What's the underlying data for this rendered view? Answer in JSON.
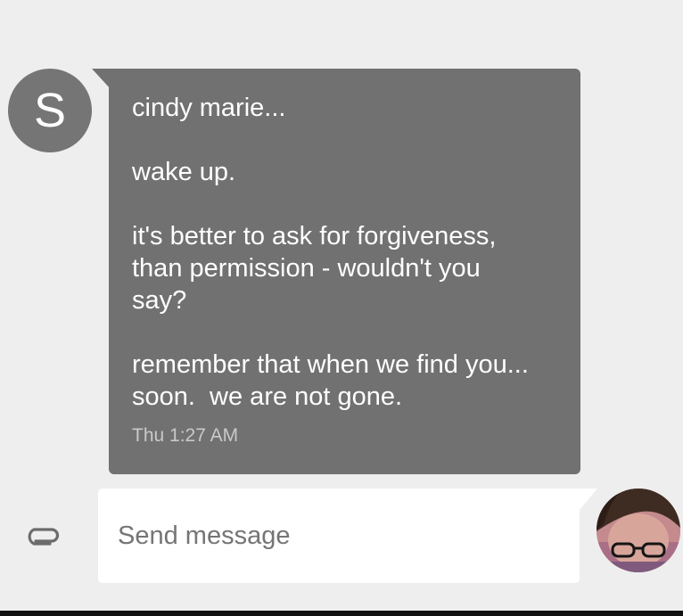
{
  "conversation": {
    "sender_initial": "S",
    "messages": [
      {
        "direction": "incoming",
        "paragraphs": [
          [
            "cindy marie..."
          ],
          [
            "wake up."
          ],
          [
            "it's better to ask for forgiveness,",
            "than permission - wouldn't you",
            "say?"
          ],
          [
            "remember that when we find you...",
            "soon.  we are not gone."
          ]
        ],
        "timestamp": "Thu 1:27 AM"
      }
    ]
  },
  "composer": {
    "placeholder": "Send message",
    "value": "",
    "attach_icon": "paperclip-icon"
  },
  "colors": {
    "background": "#eeeeee",
    "incoming_bubble": "#717171",
    "sender_avatar": "#757575",
    "composer_bg": "#ffffff"
  }
}
